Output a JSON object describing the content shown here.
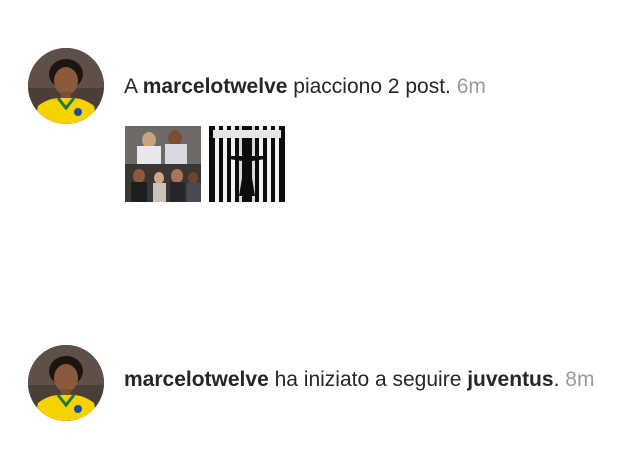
{
  "notifications": [
    {
      "prefix": "A ",
      "username": "marcelotwelve",
      "action": " piacciono 2 post.",
      "time": "6m"
    },
    {
      "username": "marcelotwelve",
      "action": " ha iniziato a seguire ",
      "target": "juventus",
      "punct": ".",
      "time": "8m"
    }
  ],
  "colors": {
    "text": "#262626",
    "timestamp": "#9a9a9a",
    "jersey": "#f5d200"
  }
}
